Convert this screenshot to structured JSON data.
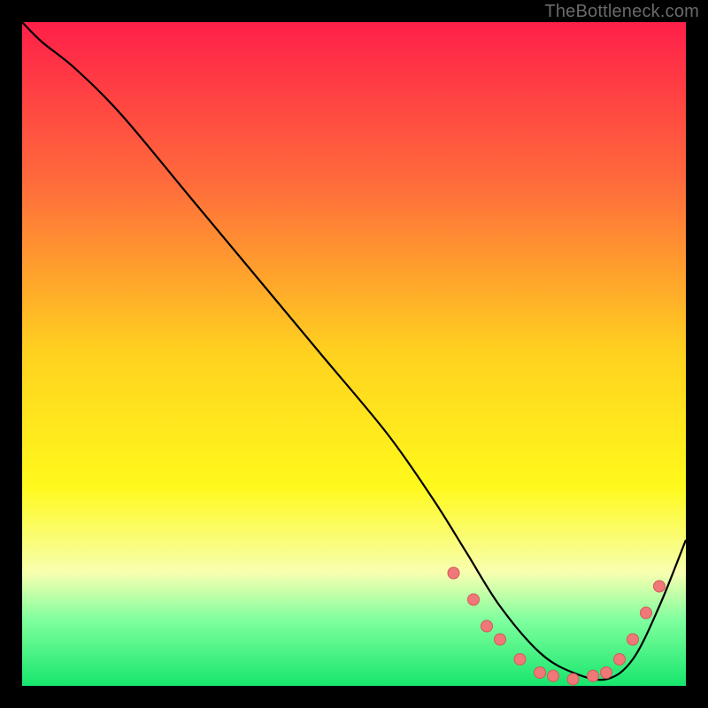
{
  "watermark": "TheBottleneck.com",
  "colors": {
    "page_bg": "#000000",
    "curve": "#000000",
    "dot_fill": "#f07878",
    "dot_stroke": "#d25a5a"
  },
  "chart_data": {
    "type": "line",
    "title": "",
    "xlabel": "",
    "ylabel": "",
    "xlim": [
      0,
      100
    ],
    "ylim": [
      0,
      100
    ],
    "gradient_stops": [
      {
        "offset": 0,
        "color": "#ff1f49"
      },
      {
        "offset": 25,
        "color": "#ff6e3b"
      },
      {
        "offset": 50,
        "color": "#ffd21f"
      },
      {
        "offset": 70,
        "color": "#fff91c"
      },
      {
        "offset": 83,
        "color": "#f7ffb0"
      },
      {
        "offset": 90,
        "color": "#80ff9e"
      },
      {
        "offset": 100,
        "color": "#17e66d"
      }
    ],
    "series": [
      {
        "name": "curve",
        "x": [
          0,
          3,
          8,
          15,
          25,
          35,
          45,
          55,
          62,
          67,
          72,
          78,
          83,
          88,
          92,
          96,
          100
        ],
        "y": [
          100,
          97,
          93,
          86,
          74,
          62,
          50,
          38,
          28,
          20,
          12,
          5,
          2,
          1,
          4,
          12,
          22
        ]
      }
    ],
    "dots": [
      {
        "x": 65,
        "y": 17
      },
      {
        "x": 68,
        "y": 13
      },
      {
        "x": 70,
        "y": 9
      },
      {
        "x": 72,
        "y": 7
      },
      {
        "x": 75,
        "y": 4
      },
      {
        "x": 78,
        "y": 2
      },
      {
        "x": 80,
        "y": 1.5
      },
      {
        "x": 83,
        "y": 1
      },
      {
        "x": 86,
        "y": 1.5
      },
      {
        "x": 88,
        "y": 2
      },
      {
        "x": 90,
        "y": 4
      },
      {
        "x": 92,
        "y": 7
      },
      {
        "x": 94,
        "y": 11
      },
      {
        "x": 96,
        "y": 15
      }
    ]
  }
}
